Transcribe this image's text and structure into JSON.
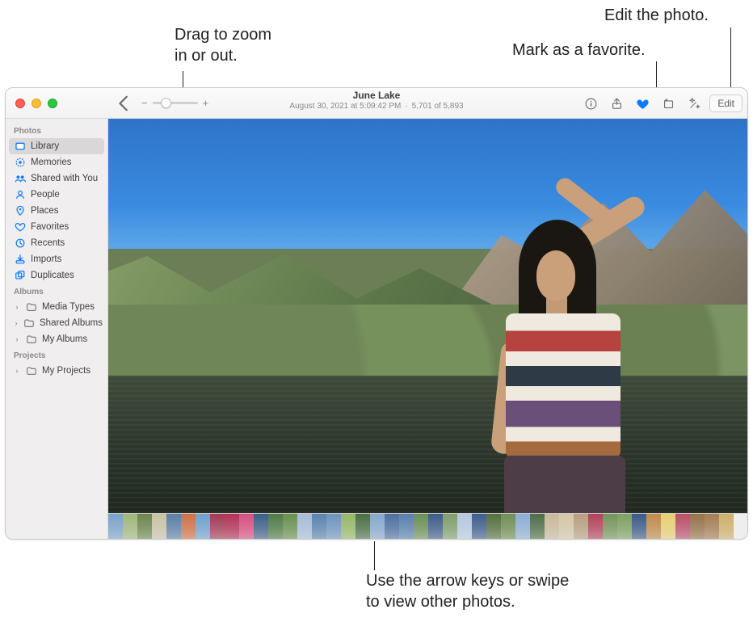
{
  "callouts": {
    "zoom": "Drag to zoom\nin or out.",
    "favorite": "Mark as a favorite.",
    "edit": "Edit the photo.",
    "filmstrip": "Use the arrow keys or swipe\nto view other photos."
  },
  "toolbar": {
    "title": "June Lake",
    "subtitle_date": "August 30, 2021 at 5:09:42 PM",
    "subtitle_count": "5,701 of 5,893",
    "zoom_minus": "−",
    "zoom_plus": "+",
    "edit_label": "Edit"
  },
  "sidebar": {
    "s1": "Photos",
    "photos": [
      {
        "label": "Library",
        "icon": "library"
      },
      {
        "label": "Memories",
        "icon": "memories"
      },
      {
        "label": "Shared with You",
        "icon": "shared"
      },
      {
        "label": "People",
        "icon": "people"
      },
      {
        "label": "Places",
        "icon": "places"
      },
      {
        "label": "Favorites",
        "icon": "favorites"
      },
      {
        "label": "Recents",
        "icon": "recents"
      },
      {
        "label": "Imports",
        "icon": "imports"
      },
      {
        "label": "Duplicates",
        "icon": "duplicates"
      }
    ],
    "s2": "Albums",
    "albums": [
      {
        "label": "Media Types"
      },
      {
        "label": "Shared Albums"
      },
      {
        "label": "My Albums"
      }
    ],
    "s3": "Projects",
    "projects": [
      {
        "label": "My Projects"
      }
    ]
  },
  "filmstrip_colors": [
    "#7aa3c9",
    "#9fb77a",
    "#6c854f",
    "#c9c2a5",
    "#5b7fa6",
    "#d07043",
    "#6fa1cf",
    "#a23a55",
    "#b23256",
    "#d6507f",
    "#3c5f87",
    "#4f7a46",
    "#67904e",
    "#a7bcd7",
    "#5a83b0",
    "#6f94bd",
    "#95b866",
    "#4b6e45",
    "#86a8cd",
    "#4d6fa0",
    "#5a7fb0",
    "#6a8f57",
    "#3d5c8a",
    "#7f9f6a",
    "#b5c9df",
    "#3e5e8c",
    "#556f3f",
    "#6f8e54",
    "#8caed2",
    "#4d6e46",
    "#c8b99b",
    "#d4c6a8",
    "#b79f80",
    "#b3425a",
    "#73945a",
    "#7ea060",
    "#3d5a86",
    "#c08a4a",
    "#e6cf72",
    "#b94f6a",
    "#95724a",
    "#a37d53",
    "#cdb06a"
  ]
}
